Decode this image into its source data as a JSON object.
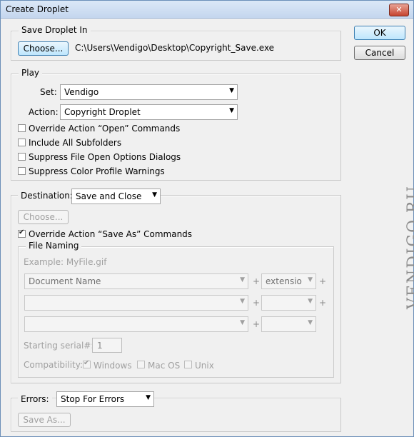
{
  "window": {
    "title": "Create Droplet",
    "close_glyph": "✕"
  },
  "buttons": {
    "ok": "OK",
    "cancel": "Cancel"
  },
  "save_droplet": {
    "legend": "Save Droplet In",
    "choose_label": "Choose...",
    "path": "C:\\Users\\Vendigo\\Desktop\\Copyright_Save.exe"
  },
  "play": {
    "legend": "Play",
    "set_label": "Set:",
    "set_value": "Vendigo",
    "action_label": "Action:",
    "action_value": "Copyright Droplet",
    "options": [
      {
        "label": "Override Action “Open” Commands",
        "checked": false
      },
      {
        "label": "Include All Subfolders",
        "checked": false
      },
      {
        "label": "Suppress File Open Options Dialogs",
        "checked": false
      },
      {
        "label": "Suppress Color Profile Warnings",
        "checked": false
      }
    ]
  },
  "destination": {
    "label": "Destination:",
    "value": "Save and Close",
    "choose_label": "Choose...",
    "override_label": "Override Action “Save As” Commands",
    "override_checked": true,
    "file_naming": {
      "legend": "File Naming",
      "example": "Example: MyFile.gif",
      "rows": [
        {
          "name": "Document Name",
          "ext": "extensio",
          "plus_after_ext": true
        },
        {
          "name": "",
          "ext": "",
          "plus_after_ext": true
        },
        {
          "name": "",
          "ext": "",
          "plus_after_ext": false
        }
      ],
      "plus": "+",
      "serial_label": "Starting serial#:",
      "serial_value": "1",
      "compat_label": "Compatibility:",
      "compat": [
        {
          "label": "Windows",
          "checked": true
        },
        {
          "label": "Mac OS",
          "checked": false
        },
        {
          "label": "Unix",
          "checked": false
        }
      ]
    }
  },
  "errors": {
    "label": "Errors:",
    "value": "Stop For Errors",
    "save_as_label": "Save As..."
  },
  "watermark": "VENDIGO.RU",
  "icons": {
    "dropdown": "chevron-down-icon",
    "close": "close-icon",
    "check": "checkmark-icon"
  }
}
